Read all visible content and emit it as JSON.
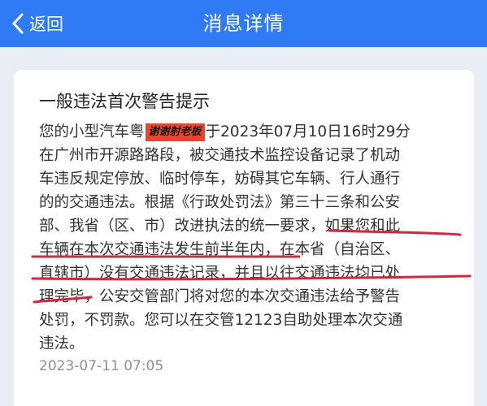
{
  "header": {
    "back_label": "返回",
    "title": "消息详情"
  },
  "card": {
    "title": "一般违法首次警告提示",
    "prefix": "您的小型汽车粤",
    "redaction_text": "谢谢射老板",
    "lines": [
      "于2023年07月10日16时29分",
      "在广州市开源路路段，被交通技术监控设备记录了机动",
      "车违反规定停放、临时停车，妨碍其它车辆、行人通行",
      "的的交通违法。根据《行政处罚法》第三十三条和公安",
      "部、我省（区、市）改进执法的统一要求，如果您和此",
      "车辆在本次交通违法发生前半年内，在本省（自治区、",
      "直辖市）没有交通违法记录，并且以往交通违法均已处",
      "理完毕，公安交管部门将对您的本次交通违法给予警告",
      "处罚，不罚款。您可以在交管12123自助处理本次交通",
      "违法。"
    ],
    "timestamp": "2023-07-11 07:05"
  },
  "colors": {
    "header": "#2f7bf6",
    "background": "#e9edf6",
    "card": "#ffffff",
    "annotation": "#e0233a"
  }
}
